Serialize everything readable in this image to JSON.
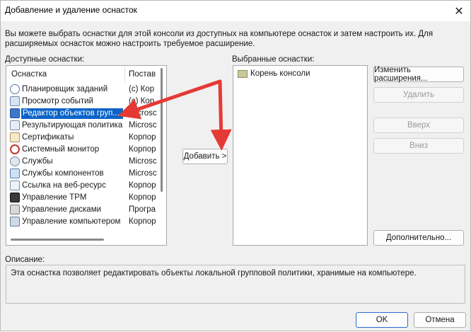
{
  "window": {
    "title": "Добавление и удаление оснасток",
    "close_glyph": "✕"
  },
  "intro_text": "Вы можете выбрать оснастки для этой консоли из доступных на компьютере оснасток и затем настроить их. Для расширяемых оснасток можно настроить требуемое расширение.",
  "available": {
    "label": "Доступные оснастки:",
    "col_snapin": "Оснастка",
    "col_vendor": "Постав",
    "items": [
      {
        "name": "Планировщик заданий",
        "vendor": "(c) Кор",
        "icon": "clock-icon"
      },
      {
        "name": "Просмотр событий",
        "vendor": "(c) Кор",
        "icon": "event-viewer-icon"
      },
      {
        "name": "Редактор объектов груп...",
        "vendor": "Microsc",
        "icon": "policy-editor-icon",
        "selected": true
      },
      {
        "name": "Результирующая политика",
        "vendor": "Microsc",
        "icon": "rsop-icon"
      },
      {
        "name": "Сертификаты",
        "vendor": "Корпор",
        "icon": "certificate-icon"
      },
      {
        "name": "Системный монитор",
        "vendor": "Корпор",
        "icon": "monitor-icon"
      },
      {
        "name": "Службы",
        "vendor": "Microsc",
        "icon": "services-icon"
      },
      {
        "name": "Службы компонентов",
        "vendor": "Microsc",
        "icon": "components-icon"
      },
      {
        "name": "Ссылка на веб-ресурс",
        "vendor": "Корпор",
        "icon": "web-link-icon"
      },
      {
        "name": "Управление TPM",
        "vendor": "Корпор",
        "icon": "tpm-icon"
      },
      {
        "name": "Управление дисками",
        "vendor": "Програ",
        "icon": "disk-icon"
      },
      {
        "name": "Управление компьютером",
        "vendor": "Корпор",
        "icon": "computer-icon"
      }
    ]
  },
  "add_button": "Добавить >",
  "selected": {
    "label": "Выбранные оснастки:",
    "root_item": "Корень консоли"
  },
  "side_buttons": {
    "edit_ext": "Изменить расширения...",
    "remove": "Удалить",
    "up": "Вверх",
    "down": "Вниз",
    "advanced": "Дополнительно..."
  },
  "description": {
    "label": "Описание:",
    "text": "Эта оснастка позволяет редактировать объекты локальной групповой политики, хранимые на компьютере."
  },
  "footer": {
    "ok": "OK",
    "cancel": "Отмена"
  },
  "colors": {
    "selection": "#0a64c8",
    "annotation_arrow": "#e53935"
  }
}
